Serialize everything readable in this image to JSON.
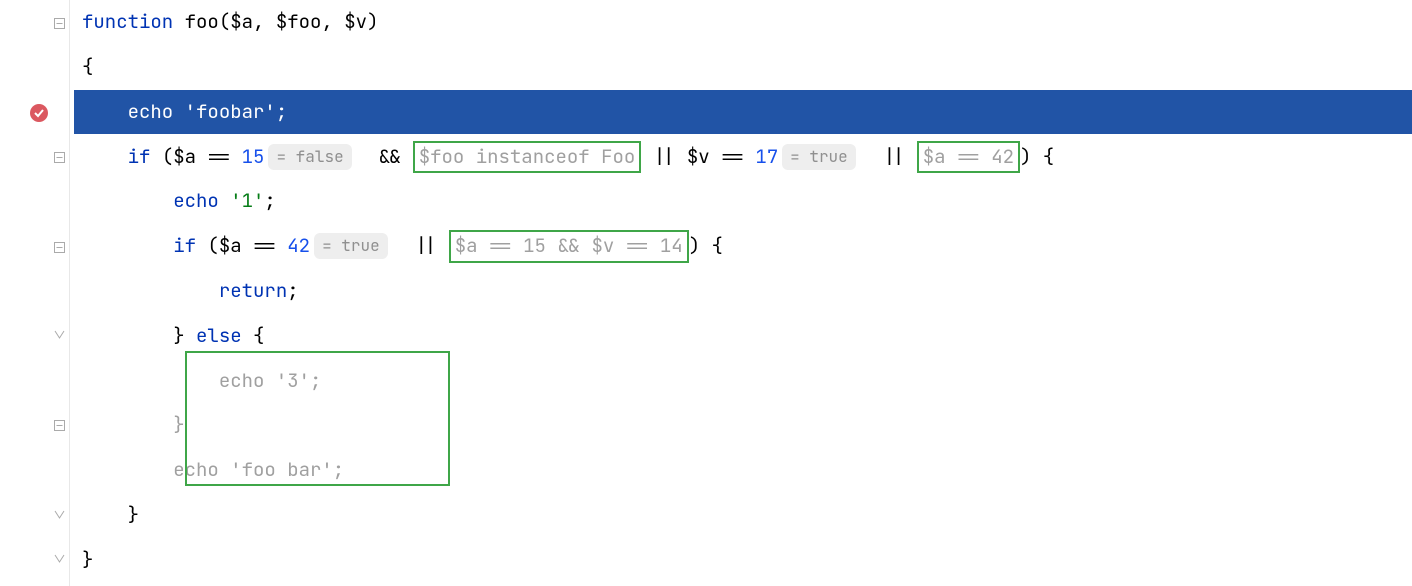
{
  "gutter": {
    "fold_icon": "fold-toggle",
    "breakpoint_icon": "breakpoint"
  },
  "code": {
    "l1": {
      "kw_function": "function",
      "fn": "foo",
      "params_open": "(",
      "p1": "$a",
      "c1": ", ",
      "p2": "$foo",
      "c2": ", ",
      "p3": "$v",
      "params_close": ")"
    },
    "l2": {
      "brace": "{"
    },
    "l3": {
      "indent": "    ",
      "echo": "echo",
      "sp": " ",
      "str": "'foobar'",
      "semi": ";"
    },
    "l4": {
      "indent": "    ",
      "if": "if",
      "open": " (",
      "v_a": "$a",
      "eq1": " == ",
      "n15": "15",
      "hint_false": "= false",
      "and": "  && ",
      "box1": "$foo instanceof Foo",
      "or1": " || ",
      "v_v": "$v",
      "eq2": " == ",
      "n17": "17",
      "hint_true": "= true",
      "or2": "  || ",
      "box2_a": "$a",
      "box2_eq": " == ",
      "box2_n": "42",
      "close": ") {"
    },
    "l5": {
      "indent": "        ",
      "echo": "echo",
      "sp": " ",
      "str": "'1'",
      "semi": ";"
    },
    "l6": {
      "indent": "        ",
      "if": "if",
      "open": " (",
      "v_a": "$a",
      "eq": " == ",
      "n42": "42",
      "hint_true": "= true",
      "or": "  || ",
      "box": "$a == 15 && $v == 14",
      "close": ") {"
    },
    "l7": {
      "indent": "            ",
      "return": "return",
      "semi": ";"
    },
    "l8": {
      "indent": "        ",
      "close": "}",
      "sp": " ",
      "else": "else",
      "open": " {"
    },
    "l9": {
      "indent": "            ",
      "text": "echo '3';"
    },
    "l10": {
      "indent": "        ",
      "brace": "}"
    },
    "l11": {
      "indent": "        ",
      "text": "echo 'foo bar';"
    },
    "l12": {
      "indent": "    ",
      "brace": "}"
    },
    "l13": {
      "brace": "}"
    }
  },
  "colors": {
    "execution_bg": "#2154a6",
    "highlight_border": "#3fa648",
    "breakpoint": "#db5860"
  }
}
